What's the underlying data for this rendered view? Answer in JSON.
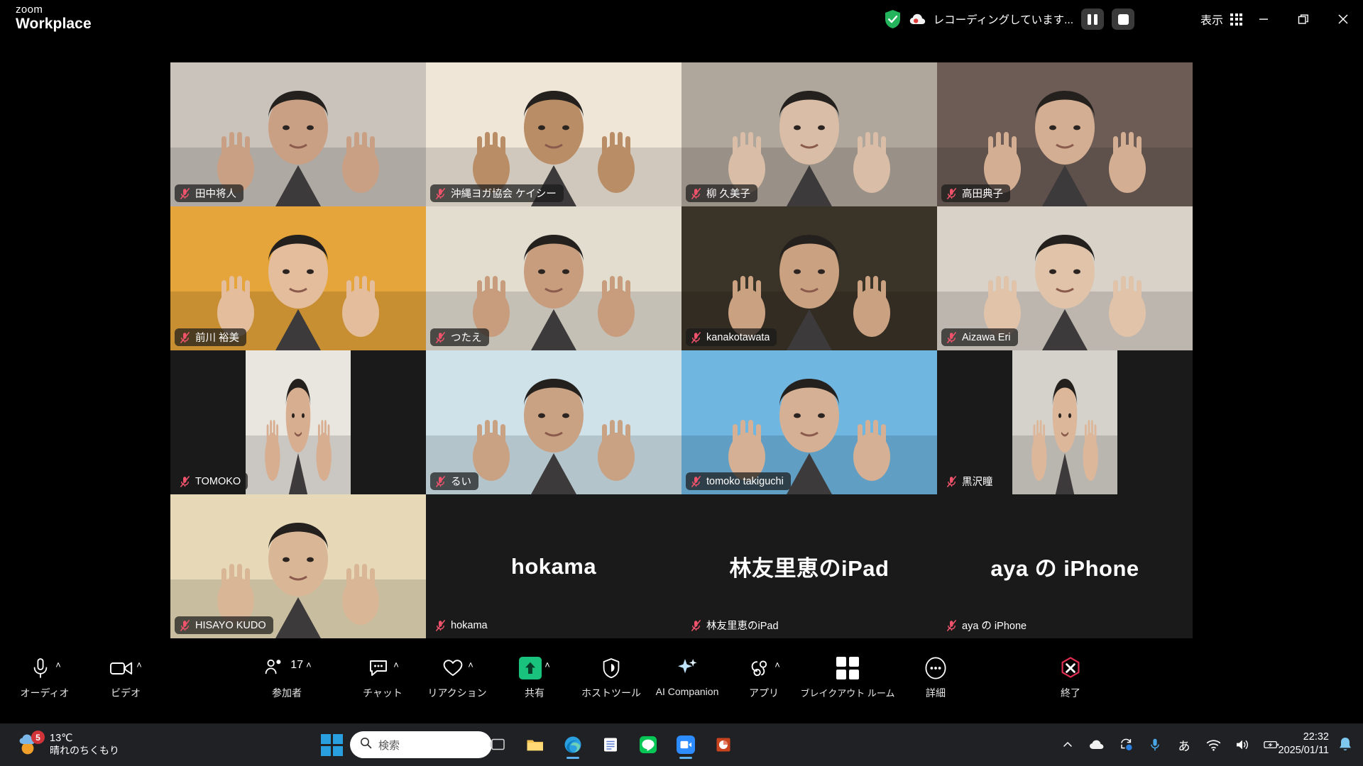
{
  "app": {
    "brand_line1": "zoom",
    "brand_line2": "Workplace"
  },
  "titlebar": {
    "recording_text": "レコーディングしています...",
    "pause_label": "一時停止",
    "stop_label": "停止",
    "view_label": "表示",
    "minimize_label": "最小化",
    "restore_label": "元に戻す",
    "close_label": "閉じる",
    "accent_green": "#2ee07a",
    "shield_green": "#23b45c"
  },
  "gallery": {
    "active_speaker": "沖縄ヨガ協会 ケイシー",
    "rows": [
      [
        {
          "name": "田中将人",
          "muted": true,
          "video": true,
          "bg": "#c9c3bc",
          "skin": "#caa084"
        },
        {
          "name": "沖縄ヨガ協会 ケイシー",
          "muted": false,
          "video": true,
          "bg": "#efe6d8",
          "skin": "#b98d66",
          "speaking": true
        },
        {
          "name": "柳 久美子",
          "muted": true,
          "video": true,
          "bg": "#b0a79c",
          "skin": "#d9bda6"
        },
        {
          "name": "高田典子",
          "muted": true,
          "video": true,
          "bg": "#6d5c55",
          "skin": "#d3ae93"
        }
      ],
      [
        {
          "name": "前川 裕美",
          "muted": true,
          "video": true,
          "bg": "#e5a53a",
          "skin": "#e3bd9c"
        },
        {
          "name": "つたえ",
          "muted": true,
          "video": true,
          "bg": "#e3ddd0",
          "skin": "#c79d7d"
        },
        {
          "name": "kanakotawata",
          "muted": true,
          "video": true,
          "bg": "#3a3328",
          "skin": "#caa181"
        },
        {
          "name": "Aizawa Eri",
          "muted": true,
          "video": true,
          "bg": "#d8d2c8",
          "skin": "#e0c3a8"
        }
      ],
      [
        {
          "name": "TOMOKO",
          "muted": true,
          "video": true,
          "bg": "#e9e5df",
          "skin": "#d8ae91",
          "narrow": true
        },
        {
          "name": "るい",
          "muted": true,
          "video": true,
          "bg": "#cfe2ea",
          "skin": "#c9a183"
        },
        {
          "name": "tomoko takiguchi",
          "muted": true,
          "video": true,
          "bg": "#6fb6e0",
          "skin": "#d6b094"
        },
        {
          "name": "黒沢瞳",
          "muted": true,
          "video": true,
          "bg": "#d5d1cb",
          "skin": "#dcb79a",
          "narrow": true
        }
      ],
      [
        {
          "name": "HISAYO KUDO",
          "muted": true,
          "video": true,
          "bg": "#e7d9b8",
          "skin": "#d9b796"
        },
        {
          "name": "hokama",
          "muted": true,
          "video": false,
          "display_name": "hokama"
        },
        {
          "name": "林友里恵のiPad",
          "muted": true,
          "video": false,
          "display_name": "林友里恵のiPad"
        },
        {
          "name": "aya の iPhone",
          "muted": true,
          "video": false,
          "display_name": "aya の iPhone"
        }
      ]
    ]
  },
  "toolbar": {
    "items": [
      {
        "key": "audio",
        "label": "オーディオ",
        "icon": "microphone-icon",
        "caret": true
      },
      {
        "key": "video",
        "label": "ビデオ",
        "icon": "camera-icon",
        "caret": true
      },
      {
        "key": "participants",
        "label": "参加者",
        "icon": "participants-icon",
        "caret": true,
        "count": "17"
      },
      {
        "key": "chat",
        "label": "チャット",
        "icon": "chat-icon",
        "caret": true
      },
      {
        "key": "reactions",
        "label": "リアクション",
        "icon": "heart-icon",
        "caret": true
      },
      {
        "key": "share",
        "label": "共有",
        "icon": "share-screen-icon",
        "caret": true,
        "accent": "#19c37d"
      },
      {
        "key": "hosttools",
        "label": "ホストツール",
        "icon": "shield-icon",
        "caret": false
      },
      {
        "key": "aicompanion",
        "label": "AI Companion",
        "icon": "sparkle-icon",
        "caret": false
      },
      {
        "key": "apps",
        "label": "アプリ",
        "icon": "apps-icon",
        "caret": true
      },
      {
        "key": "breakout",
        "label": "ブレイクアウト ルーム",
        "icon": "breakout-rooms-icon",
        "caret": false
      },
      {
        "key": "more",
        "label": "詳細",
        "icon": "ellipsis-icon",
        "caret": false
      },
      {
        "key": "end",
        "label": "終了",
        "icon": "end-call-icon",
        "caret": false,
        "accent": "#e02d52"
      }
    ]
  },
  "taskbar": {
    "weather": {
      "temperature": "13℃",
      "condition": "晴れのちくもり",
      "badge": "5"
    },
    "start_label": "スタート",
    "search_placeholder": "検索",
    "apps": [
      {
        "name": "task-view",
        "label": "タスク ビュー"
      },
      {
        "name": "file-explorer",
        "label": "エクスプローラー"
      },
      {
        "name": "edge",
        "label": "Microsoft Edge"
      },
      {
        "name": "notes",
        "label": "メモ"
      },
      {
        "name": "line",
        "label": "LINE"
      },
      {
        "name": "zoom",
        "label": "Zoom"
      },
      {
        "name": "powerpoint",
        "label": "PowerPoint"
      }
    ],
    "tray": [
      {
        "name": "show-hidden-icons",
        "label": "隠れているインジケーターを表示"
      },
      {
        "name": "onedrive-icon",
        "label": "OneDrive"
      },
      {
        "name": "sync-icon",
        "label": "同期"
      },
      {
        "name": "microphone-icon",
        "label": "マイク"
      },
      {
        "name": "ime-icon",
        "label": "あ"
      },
      {
        "name": "wifi-icon",
        "label": "ネットワーク"
      },
      {
        "name": "volume-icon",
        "label": "音量"
      },
      {
        "name": "battery-icon",
        "label": "バッテリー"
      }
    ],
    "clock": {
      "time": "22:32",
      "date": "2025/01/11"
    },
    "notification_label": "通知"
  }
}
